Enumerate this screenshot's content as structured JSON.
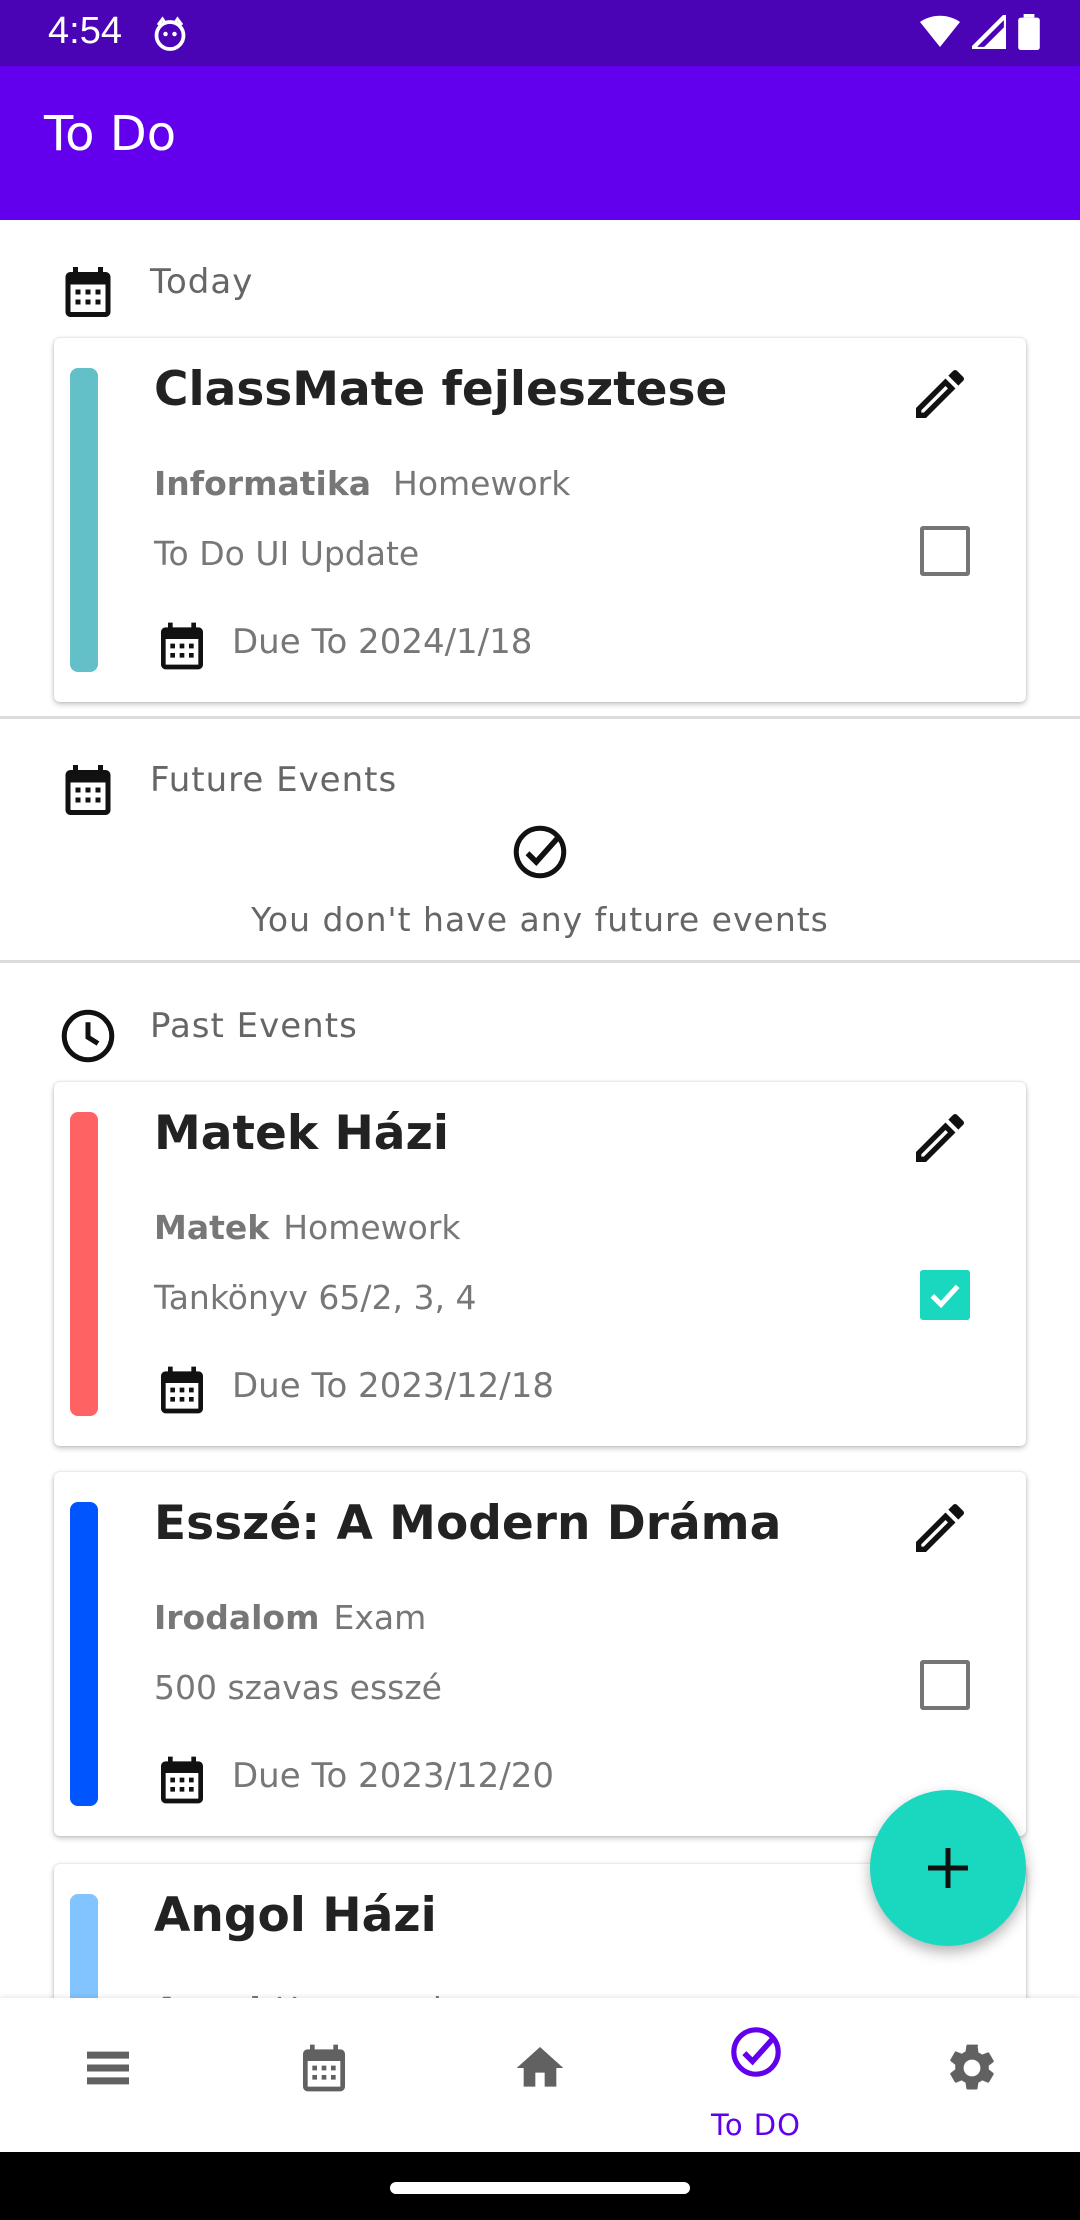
{
  "status_bar": {
    "time": "4:54"
  },
  "app_bar": {
    "title": "To Do"
  },
  "sections": {
    "today": {
      "label": "Today"
    },
    "future": {
      "label": "Future Events",
      "empty_message": "You don't have any future events"
    },
    "past": {
      "label": "Past Events"
    }
  },
  "tasks": [
    {
      "title": "ClassMate fejlesztese",
      "subject": "Informatika",
      "type": "Homework",
      "description": "To Do UI Update",
      "due": "Due To 2024/1/18",
      "done": false,
      "color": "#64c0c8"
    },
    {
      "title": "Matek Házi",
      "subject": "Matek",
      "type": "Homework",
      "description": "Tankönyv 65/2, 3, 4",
      "due": "Due To 2023/12/18",
      "done": true,
      "color": "#ff6262"
    },
    {
      "title": "Esszé: A Modern Dráma",
      "subject": "Irodalom",
      "type": "Exam",
      "description": "500 szavas esszé",
      "due": "Due To 2023/12/20",
      "done": false,
      "color": "#0055ff"
    },
    {
      "title": "Angol Házi",
      "subject": "Angol",
      "type": "Homework",
      "color": "#82c4ff"
    }
  ],
  "bottom_nav": {
    "items": [
      {
        "icon": "list-icon"
      },
      {
        "icon": "calendar-icon"
      },
      {
        "icon": "home-icon"
      },
      {
        "icon": "check-circle-icon",
        "label": "To DO",
        "active": true
      },
      {
        "icon": "gear-icon"
      }
    ]
  },
  "colors": {
    "primary": "#6200ee",
    "status_bar": "#4a03b5",
    "accent": "#1ad7bf"
  }
}
